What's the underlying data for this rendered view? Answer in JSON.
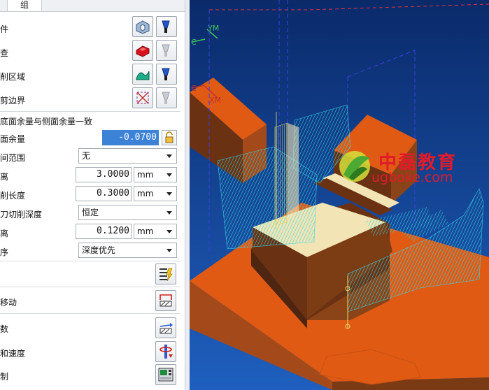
{
  "tabs": {
    "group": "组"
  },
  "geometry_rows": [
    {
      "label": "件"
    },
    {
      "label": "查"
    },
    {
      "label": "削区域"
    },
    {
      "label": "剪边界"
    }
  ],
  "floor_wall_same": "底面余量与侧面余量一致",
  "fields": {
    "floor_stock": {
      "label": "面余量",
      "value": "-0.0700"
    },
    "range": {
      "label": "间范围",
      "value": "无"
    },
    "distance1": {
      "label": "离",
      "value": "3.0000",
      "unit": "mm"
    },
    "cut_length": {
      "label": "削长度",
      "value": "0.3000",
      "unit": "mm"
    },
    "depth_mode": {
      "label": "刀切削深度",
      "value": "恒定"
    },
    "distance2": {
      "label": "离",
      "value": "0.1200",
      "unit": "mm"
    },
    "order": {
      "label": "序",
      "value": "深度优先"
    }
  },
  "bottom_rows": [
    {
      "label": "移动"
    },
    {
      "label": "数"
    },
    {
      "label": "和速度"
    },
    {
      "label": "制"
    }
  ],
  "viewport": {
    "axis_labels": [
      "YM",
      "C",
      "C",
      "XM"
    ],
    "watermark_title": "中磊教育",
    "watermark_url": "ugboke.com",
    "colors": {
      "background_top": "#0a2a6a",
      "background_bottom": "#1f5fbf",
      "orange": "#e05a14",
      "brown": "#6a3212",
      "toolpath": "#33d8e6",
      "cream": "#f2e4b4"
    }
  }
}
